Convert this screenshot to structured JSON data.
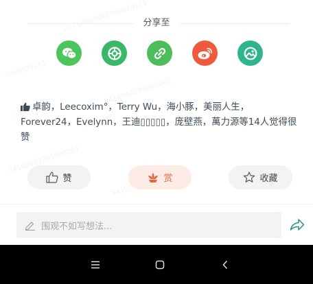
{
  "share": {
    "title": "分享至",
    "targets": [
      {
        "name": "wechat",
        "icon": "wechat-icon",
        "color": "#4cc55a"
      },
      {
        "name": "moments",
        "icon": "moments-icon",
        "color": "#3ab86a"
      },
      {
        "name": "link",
        "icon": "link-icon",
        "color": "#4dbc5a"
      },
      {
        "name": "weibo",
        "icon": "weibo-icon",
        "color": "#f05a3c"
      },
      {
        "name": "other",
        "icon": "landscape-icon",
        "color": "#2fb58e"
      }
    ]
  },
  "likes": {
    "icon": "thumbs-up-icon",
    "text": "卓韵，Leecoxim°，Terry Wu，海小豚，美丽人生，Forever24，Evelynn，王迪▯▯▯▯▯，庞壁燕，萬力源等14人觉得很赞"
  },
  "actions": {
    "like_label": "赞",
    "reward_label": "赏",
    "collect_label": "收藏",
    "reward_color": "#e3663d"
  },
  "comment": {
    "placeholder": "围观不如写想法...",
    "pen_icon": "pen-icon",
    "send_icon": "send-icon"
  },
  "nav": {
    "menu_icon": "menu-icon",
    "home_icon": "home-icon",
    "back_icon": "back-icon"
  }
}
